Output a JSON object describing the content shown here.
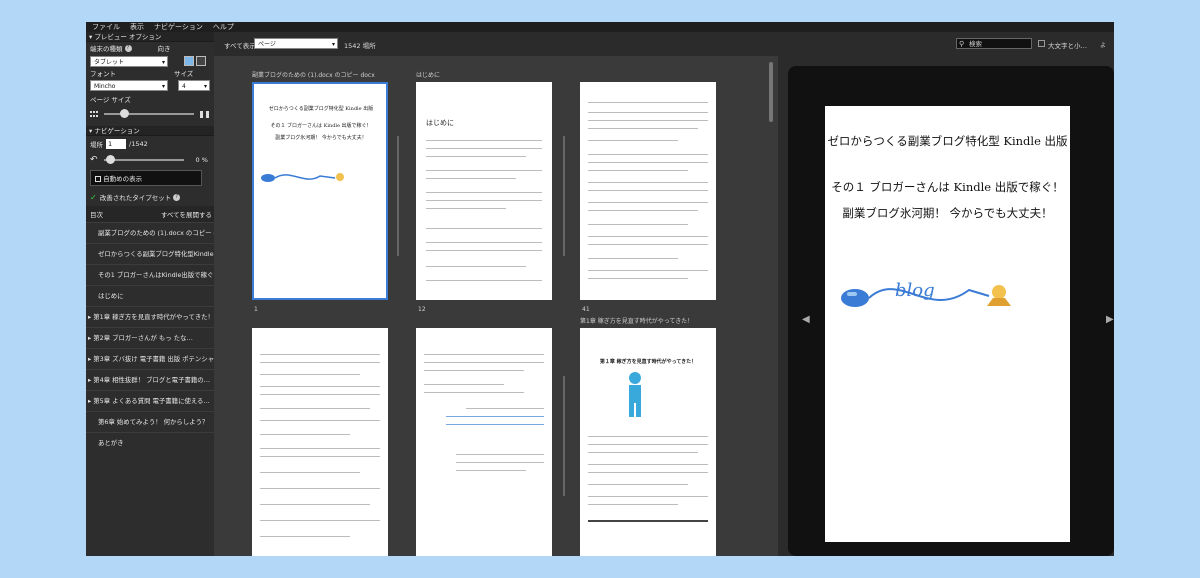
{
  "menu": [
    "ファイル",
    "表示",
    "ナビゲーション",
    "ヘルプ"
  ],
  "sidebar": {
    "preview_header": "プレビュー オプション",
    "device_label": "端末の種類",
    "orientation_label": "向き",
    "device_value": "タブレット",
    "font_label": "フォント",
    "size_label": "サイズ",
    "font_value": "Mincho",
    "size_value": "4",
    "page_size_label": "ページ サイズ",
    "nav_header": "ナビゲーション",
    "location_label": "場所",
    "location_value": "1",
    "location_total": "/1542",
    "zoom_value": "0 %",
    "auto_display": "自動めの表示",
    "typeset_label": "改善されたタイプセット",
    "toc_header": "目次",
    "expand_all": "すべてを展開する",
    "toc": [
      "副業ブログのための (1).docx のコピー docx",
      "ゼロからつくる副業ブログ特化型Kindle出版",
      "その1 ブロガーさんはKindle出版で稼ぐ！…",
      "はじめに",
      "第1章 稼ぎ方を見直す時代がやってきた！",
      "第2章 ブロガーさんが もっ たな…",
      "第3章 ズバ抜け 電子書籍 出版 ポテンシャ…",
      "第4章 相性抜群！ ブログと電子書籍の…",
      "第5章 よくある質問 電子書籍に使える…",
      "第6章 始めてみよう！ 何からしよう？",
      "あとがき"
    ]
  },
  "toolbar": {
    "show_all_label": "すべて表示",
    "view_value": "ページ",
    "location_count": "1542 場所",
    "search_placeholder": "検索",
    "case_label": "大文字と小…"
  },
  "pages": {
    "header1": "副業ブログのための (1).docx のコピー docx",
    "header2": "はじめに",
    "header3": "第1章 稼ぎ方を見直す時代がやってきた！",
    "num1": "1",
    "num2": "12",
    "num3": "41",
    "thumb1_title": "ゼロからつくる副業ブログ特化型 Kindle 出版",
    "thumb1_sub": "その１ ブロガーさんは Kindle 出版で稼ぐ！",
    "thumb1_sub2": "副業ブログ氷河期！ 今からでも大丈夫！",
    "thumb2_heading": "はじめに",
    "thumb6_heading": "第１章 稼ぎ方を見直す時代がやってきた！"
  },
  "device": {
    "title": "ゼロからつくる副業ブログ特化型 Kindle 出版",
    "line2": "その１ ブロガーさんは Kindle 出版で稼ぐ！",
    "line3": "副業ブログ氷河期！ 今からでも大丈夫！",
    "logo_text": "blog"
  },
  "colors": {
    "accent": "#3a7bd5",
    "background": "#b2d7f7"
  }
}
